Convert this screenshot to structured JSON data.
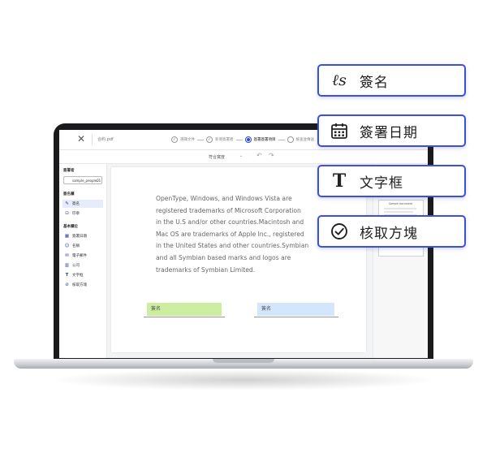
{
  "app": {
    "document_name": "合約.pdf",
    "steps": [
      "選擇文件",
      "新增簽署者",
      "簽署簽署項目",
      "檢查並傳送"
    ],
    "active_step_index": 2
  },
  "toolbar": {
    "zoom_label": "符合寬度"
  },
  "sidebar": {
    "signer_section_title": "簽署者",
    "signer_value": "sample_people01",
    "signature_section_title": "簽名欄",
    "signature_items": [
      {
        "label": "簽名",
        "icon": "signature-icon",
        "selected": true
      },
      {
        "label": "印章",
        "icon": "stamp-icon",
        "selected": false
      }
    ],
    "basic_section_title": "基本欄位",
    "basic_items": [
      {
        "label": "簽署日期",
        "icon": "calendar-icon"
      },
      {
        "label": "名稱",
        "icon": "person-icon"
      },
      {
        "label": "電子郵件",
        "icon": "mail-icon"
      },
      {
        "label": "公司",
        "icon": "building-icon"
      },
      {
        "label": "文字框",
        "icon": "text-icon"
      },
      {
        "label": "核取方塊",
        "icon": "checkbox-icon"
      }
    ]
  },
  "document": {
    "lines": [
      "OpenType, Windows, and Windows Vista are",
      "registered trademarks of Microsoft Corporation",
      "in the U.S and/or other countries.Macintosh and",
      "Mac OS are trademarks of Apple Inc., registered",
      "in the United States and other countries.Symbian",
      "and all Symbian based marks and logos are",
      "trademarks of Symbian Limited."
    ],
    "field_green_label": "簽名",
    "field_blue_label": "簽名"
  },
  "thumbnail": {
    "title": "Sample document"
  },
  "callouts": [
    {
      "label": "簽名",
      "icon": "signature-icon"
    },
    {
      "label": "簽署日期",
      "icon": "calendar-icon"
    },
    {
      "label": "文字框",
      "icon": "text-icon"
    },
    {
      "label": "核取方塊",
      "icon": "checkbox-icon"
    }
  ],
  "colors": {
    "accent": "#3d4fe0",
    "field_green": "#cdeea0",
    "field_blue": "#d4e6fb"
  }
}
